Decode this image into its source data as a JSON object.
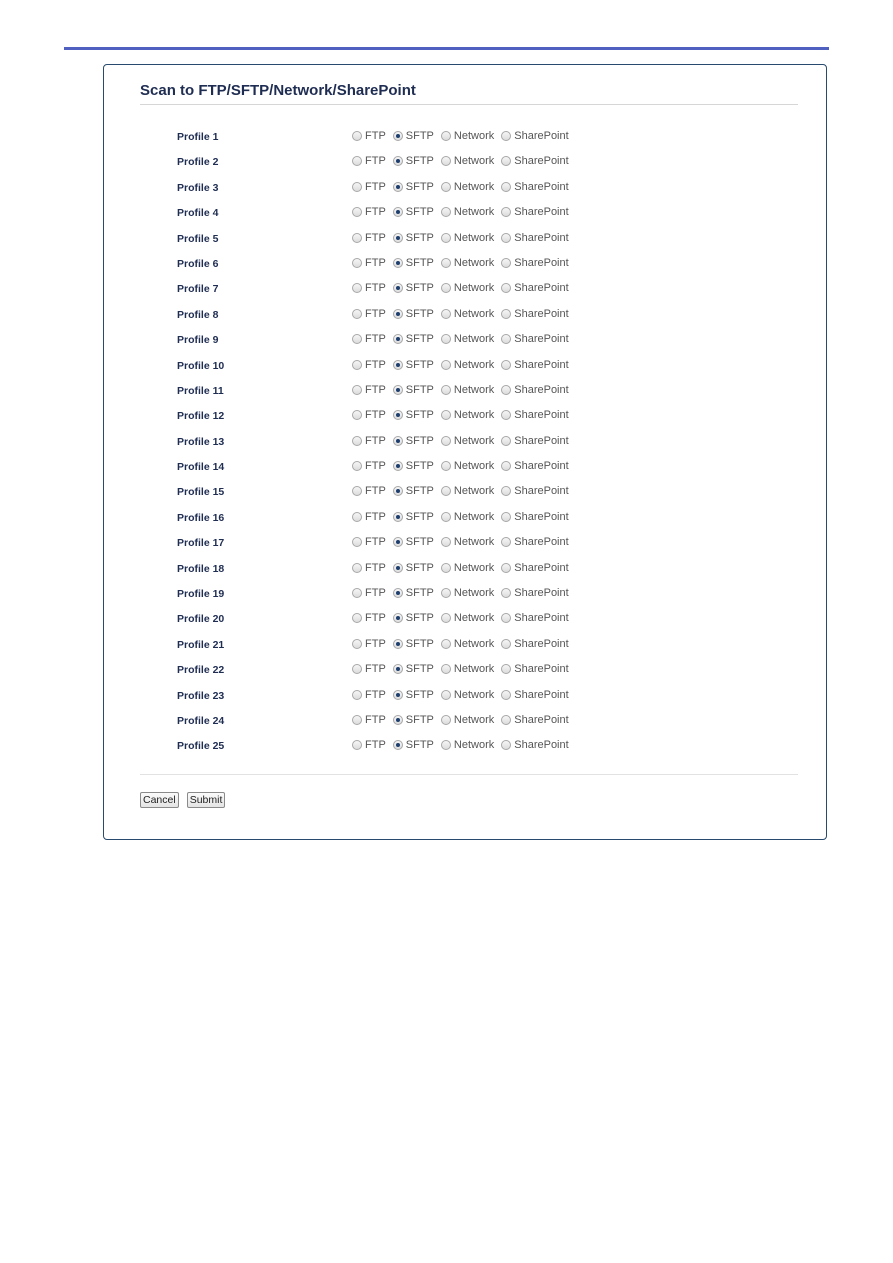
{
  "page": {
    "title": "Scan to FTP/SFTP/Network/SharePoint"
  },
  "options": [
    "FTP",
    "SFTP",
    "Network",
    "SharePoint"
  ],
  "profiles": [
    {
      "label": "Profile 1",
      "selected": "SFTP"
    },
    {
      "label": "Profile 2",
      "selected": "SFTP"
    },
    {
      "label": "Profile 3",
      "selected": "SFTP"
    },
    {
      "label": "Profile 4",
      "selected": "SFTP"
    },
    {
      "label": "Profile 5",
      "selected": "SFTP"
    },
    {
      "label": "Profile 6",
      "selected": "SFTP"
    },
    {
      "label": "Profile 7",
      "selected": "SFTP"
    },
    {
      "label": "Profile 8",
      "selected": "SFTP"
    },
    {
      "label": "Profile 9",
      "selected": "SFTP"
    },
    {
      "label": "Profile 10",
      "selected": "SFTP"
    },
    {
      "label": "Profile 11",
      "selected": "SFTP"
    },
    {
      "label": "Profile 12",
      "selected": "SFTP"
    },
    {
      "label": "Profile 13",
      "selected": "SFTP"
    },
    {
      "label": "Profile 14",
      "selected": "SFTP"
    },
    {
      "label": "Profile 15",
      "selected": "SFTP"
    },
    {
      "label": "Profile 16",
      "selected": "SFTP"
    },
    {
      "label": "Profile 17",
      "selected": "SFTP"
    },
    {
      "label": "Profile 18",
      "selected": "SFTP"
    },
    {
      "label": "Profile 19",
      "selected": "SFTP"
    },
    {
      "label": "Profile 20",
      "selected": "SFTP"
    },
    {
      "label": "Profile 21",
      "selected": "SFTP"
    },
    {
      "label": "Profile 22",
      "selected": "SFTP"
    },
    {
      "label": "Profile 23",
      "selected": "SFTP"
    },
    {
      "label": "Profile 24",
      "selected": "SFTP"
    },
    {
      "label": "Profile 25",
      "selected": "SFTP"
    }
  ],
  "buttons": {
    "cancel": "Cancel",
    "submit": "Submit"
  },
  "colors": {
    "accent_rule": "#5060c0",
    "panel_border": "#274a6e",
    "heading_text": "#1f2d52",
    "radio_checked": "#1e3f6e"
  }
}
